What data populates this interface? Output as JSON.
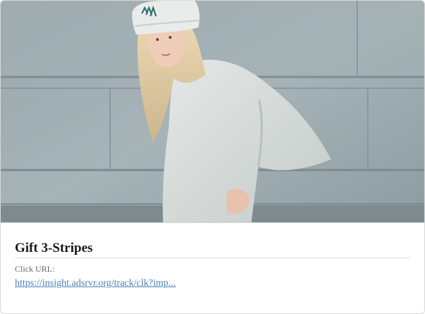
{
  "card": {
    "title": "Gift 3-Stripes",
    "click_label": "Click URL:",
    "click_url": "https://insight.adsrvr.org/track/clk?imp...",
    "image": {
      "subject": "model-in-beanie-and-oversized-tee"
    }
  },
  "colors": {
    "link": "#4a7fb5",
    "title": "#1a1a1a",
    "label": "#666666"
  }
}
